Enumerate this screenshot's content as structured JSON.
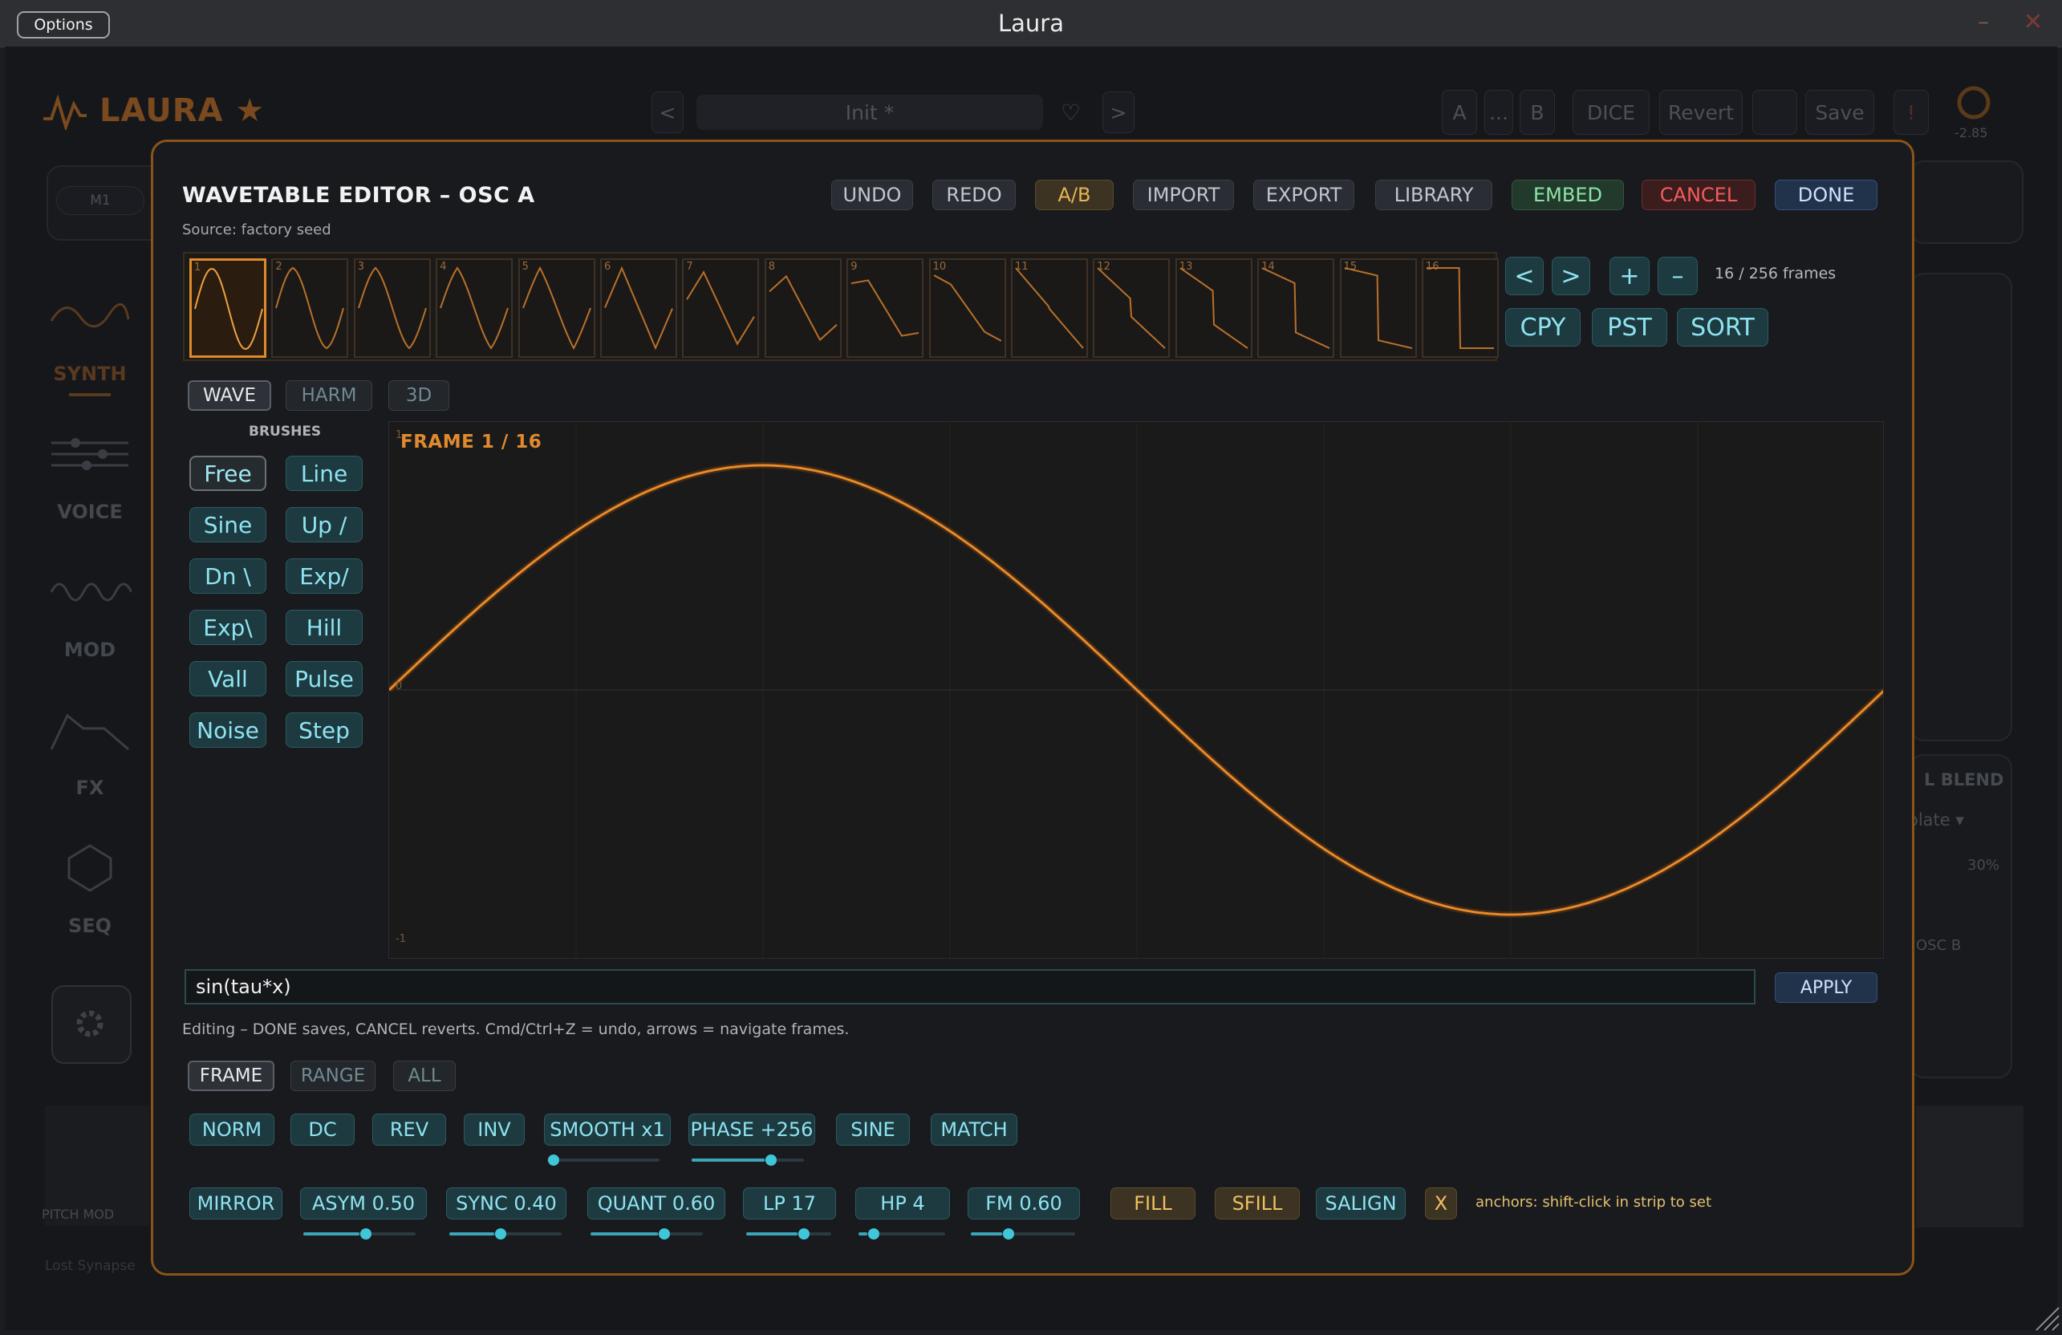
{
  "window": {
    "title": "Laura",
    "options_label": "Options",
    "min_glyph": "–",
    "close_glyph": "✕"
  },
  "background": {
    "logo_text": "LAURA ★",
    "preset_name": "Init *",
    "prev_glyph": "<",
    "next_glyph": ">",
    "heart_glyph": "♡",
    "ab_a": "A",
    "ab_dots": "...",
    "ab_b": "B",
    "dice": "DICE",
    "revert": "Revert",
    "save": "Save",
    "alert": "!",
    "knob_value": "-2.85",
    "macro_label": "M1",
    "sidebar": [
      "SYNTH",
      "VOICE",
      "MOD",
      "FX",
      "SEQ"
    ],
    "blend_label": "L BLEND",
    "interp_label": "olate ▾",
    "pct_label": "30%",
    "oscb_label": "OSC B",
    "pitch_mod_label": "PITCH  MOD",
    "footer_label": "Lost Synapse"
  },
  "editor": {
    "title": "WAVETABLE EDITOR  –  OSC A",
    "source": "Source: factory seed",
    "toolbar": [
      "UNDO",
      "REDO",
      "A/B",
      "IMPORT",
      "EXPORT",
      "LIBRARY",
      "EMBED",
      "CANCEL",
      "DONE"
    ],
    "frames": [
      "1",
      "2",
      "3",
      "4",
      "5",
      "6",
      "7",
      "8",
      "9",
      "10",
      "11",
      "12",
      "13",
      "14",
      "15",
      "16"
    ],
    "selected_frame": 1,
    "nav": {
      "prev": "<",
      "next": ">",
      "add": "+",
      "remove": "–"
    },
    "frame_count": "16 / 256 frames",
    "clip": {
      "copy": "CPY",
      "paste": "PST",
      "sort": "SORT"
    },
    "view_tabs": [
      "WAVE",
      "HARM",
      "3D"
    ],
    "active_view_tab": "WAVE",
    "brushes_label": "BRUSHES",
    "brushes": [
      "Free",
      "Line",
      "Sine",
      "Up /",
      "Dn \\",
      "Exp/",
      "Exp\\",
      "Hill",
      "Vall",
      "Pulse",
      "Noise",
      "Step"
    ],
    "active_brush": "Free",
    "canvas_label": "FRAME 1 / 16",
    "axis_top": "1",
    "axis_mid": "0",
    "axis_bottom": "-1",
    "expression": "sin(tau*x)",
    "apply": "APPLY",
    "hint": "Editing – DONE saves, CANCEL reverts. Cmd/Ctrl+Z = undo, arrows = navigate frames.",
    "scope_tabs": [
      "FRAME",
      "RANGE",
      "ALL"
    ],
    "active_scope": "FRAME",
    "ops_row1": [
      {
        "label": "NORM"
      },
      {
        "label": "DC"
      },
      {
        "label": "REV"
      },
      {
        "label": "INV"
      },
      {
        "label": "SMOOTH x1",
        "slider": 0.0
      },
      {
        "label": "PHASE +256",
        "slider": 0.65
      },
      {
        "label": "SINE"
      },
      {
        "label": "MATCH"
      }
    ],
    "ops_row2": [
      {
        "label": "MIRROR"
      },
      {
        "label": "ASYM 0.50",
        "slider": 0.5
      },
      {
        "label": "SYNC 0.40",
        "slider": 0.4
      },
      {
        "label": "QUANT 0.60",
        "slider": 0.6
      },
      {
        "label": "LP 17",
        "slider": 0.6
      },
      {
        "label": "HP 4",
        "slider": 0.1
      },
      {
        "label": "FM 0.60",
        "slider": 0.3
      },
      {
        "label": "FILL"
      },
      {
        "label": "SFILL"
      },
      {
        "label": "SALIGN"
      },
      {
        "label": "X"
      }
    ],
    "anchors_hint": "anchors: shift-click in strip to set"
  },
  "colors": {
    "accent": "#e08a2a",
    "cyan": "#8fe3f0",
    "modal_border": "#8a5418"
  }
}
